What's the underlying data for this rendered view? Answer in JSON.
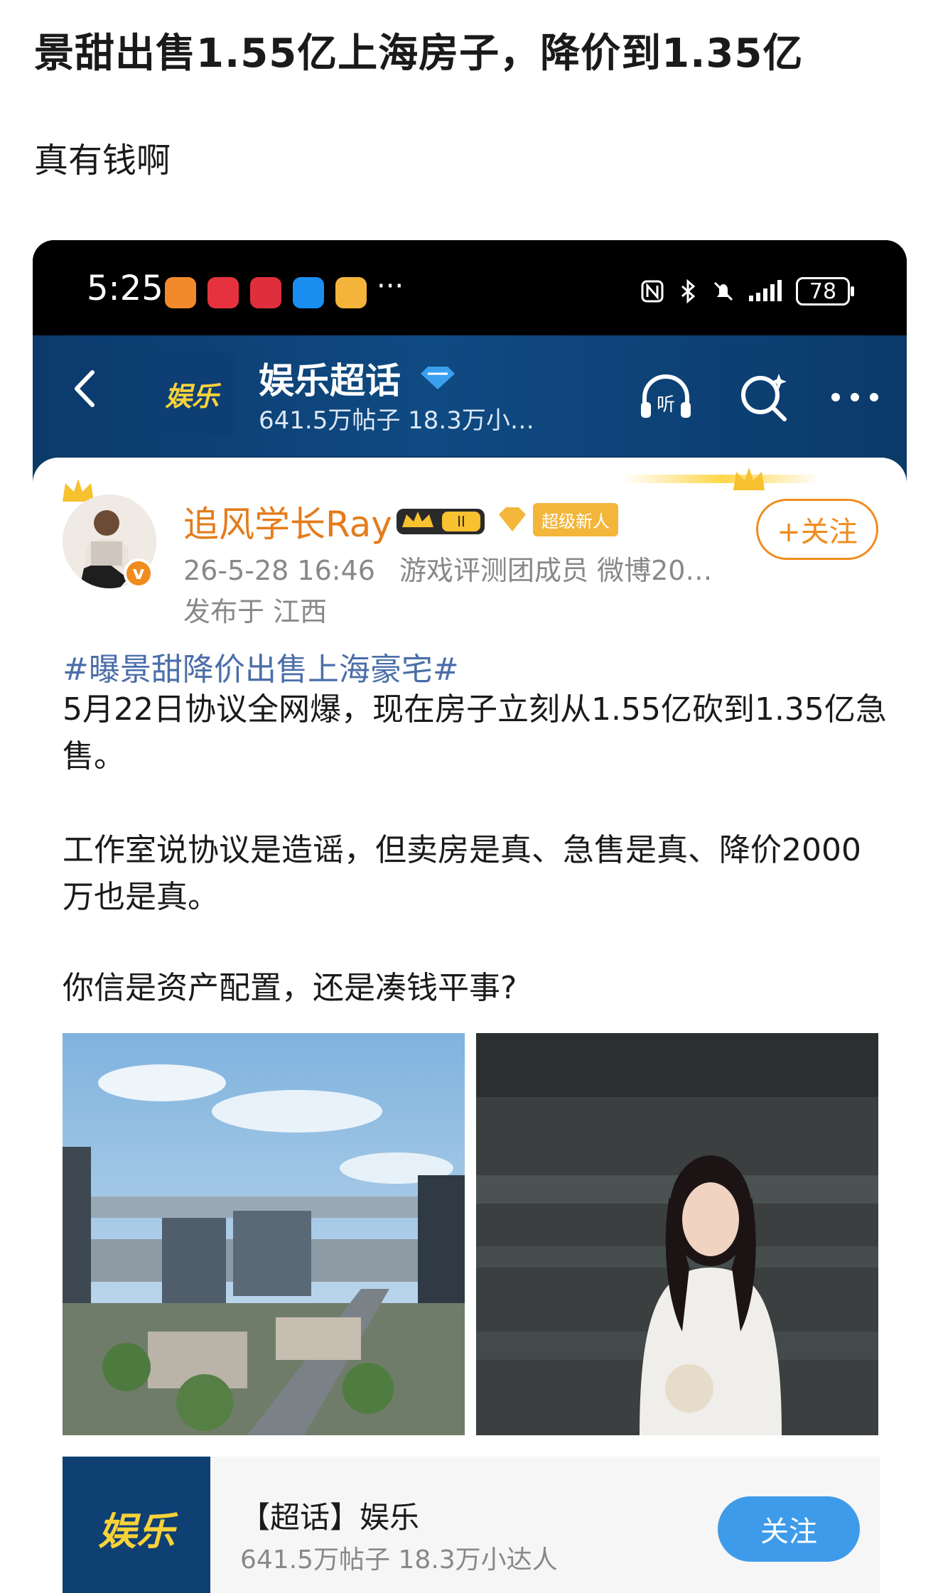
{
  "post": {
    "title": "景甜出售1.55亿上海房子，降价到1.35亿",
    "body": "真有钱啊"
  },
  "status_bar": {
    "time": "5:25",
    "more": "···",
    "battery": "78"
  },
  "header": {
    "group_title": "娱乐超话",
    "group_sub": "641.5万帖子 18.3万小…",
    "logo_text": "娱乐"
  },
  "weibo": {
    "author": "追风学长Ray",
    "level_badge": "II",
    "super_badge": "超级新人",
    "follow_label": "+关注",
    "avatar_badge": "v",
    "time": "26-5-28 16:46",
    "meta": "游戏评测团成员 微博20…",
    "location": "发布于 江西",
    "topic": "#曝景甜降价出售上海豪宅#",
    "para1": "5月22日协议全网爆，现在房子立刻从1.55亿砍到1.35亿急售。",
    "para2": "工作室说协议是造谣，但卖房是真、急售是真、降价2000万也是真。",
    "para3": "你信是资产配置，还是凑钱平事?"
  },
  "topic_card": {
    "name": "【超话】娱乐",
    "stats": "641.5万帖子 18.3万小达人",
    "follow_label": "关注",
    "logo_text": "娱乐"
  },
  "colors": {
    "nav_blue": "#0f4a82",
    "accent_orange": "#f08c1e",
    "topic_blue": "#4b6ea9",
    "follow_blue": "#3e9be9"
  }
}
